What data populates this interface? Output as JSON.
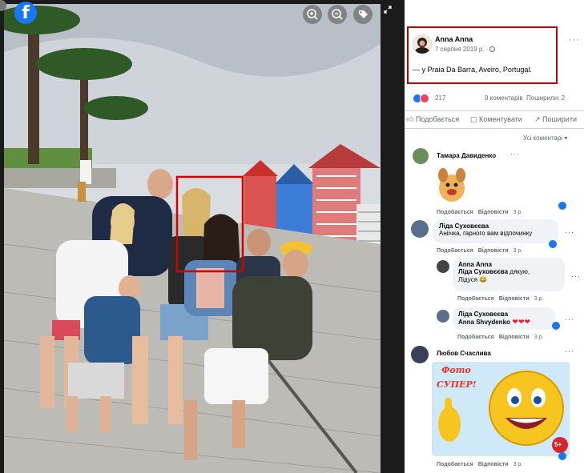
{
  "viewer": {
    "brand_icon": "facebook-logo",
    "brand_letter": "f",
    "zoom_in_icon": "zoom-in-icon",
    "zoom_out_icon": "zoom-out-icon",
    "tag_icon": "tag-icon",
    "fullscreen_icon": "fullscreen-icon"
  },
  "post": {
    "author": "Anna Anna",
    "date": "7 серпня 2019 р. ·",
    "location": "— у Praia Da Barra, Aveiro, Portugal.",
    "reaction_count": "217",
    "comments": "9 коментарів",
    "shares": "Поширили: 2",
    "actions": [
      "Подобається",
      "Коментувати",
      "Поширити"
    ],
    "sort_label": "Усі коментарі ▾",
    "more": "···"
  },
  "comments": [
    {
      "author": "Тамара Давиденко",
      "text": "",
      "sticker": "dog-sticker",
      "actions": [
        "Подобається",
        "Відповісти",
        "3 р."
      ]
    },
    {
      "author": "Ліда Суховєєва",
      "text": "Аніічка, гарного вам відпочинку",
      "actions": [
        "Подобається",
        "Відповісти",
        "3 р."
      ]
    },
    {
      "author": "Anna Anna",
      "mention": "Ліда Суховєєва",
      "text": " дякую,",
      "text2": "Лідуся",
      "actions": [
        "Подобається",
        "Відповісти",
        "3 р."
      ]
    },
    {
      "author": "Ліда Суховєєва",
      "mention": "Anna Shvydenko",
      "text": " ❤❤❤",
      "actions": [
        "Подобається",
        "Відповісти",
        "3 р."
      ]
    },
    {
      "author": "Любов Счаслива",
      "text": "",
      "sticker": "super-smiley-sticker",
      "sticker_text_1": "Фото",
      "sticker_text_2": "СУПЕР!",
      "sticker_badge": "5+",
      "actions": [
        "Подобається",
        "Відповісти",
        "3 р."
      ]
    }
  ],
  "colors": {
    "facebook_blue": "#1877f2",
    "highlight_red": "#c40000",
    "meta_gray": "#65676b"
  }
}
